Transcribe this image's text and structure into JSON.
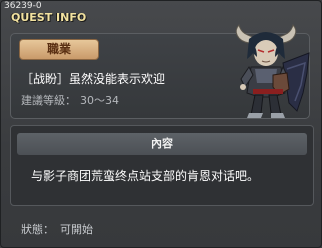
{
  "window": {
    "quest_id": "36239-0",
    "title": "QUEST INFO"
  },
  "quest": {
    "job_label": "職業",
    "name": "［战盼］虽然没能表示欢迎",
    "level_label": "建議等級：",
    "level_range": "30～34",
    "npc_icon": "horned-demon-npc-portrait"
  },
  "content": {
    "header": "內容",
    "text": "与影子商团荒蛮终点站支部的肯恩对话吧。"
  },
  "status": {
    "label": "狀態：",
    "value": "可開始"
  },
  "colors": {
    "title": "#f2e2a0",
    "job_badge": "#d8b080",
    "background": "#3b3d40"
  }
}
